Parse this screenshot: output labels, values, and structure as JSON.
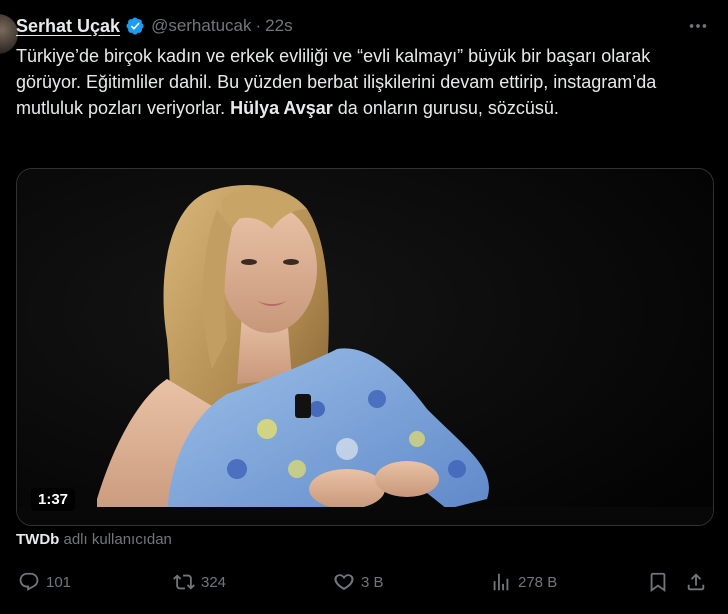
{
  "author": {
    "name": "Serhat Uçak",
    "handle": "@serhatucak",
    "separator": "·",
    "time": "22s",
    "verified_icon": "verified-badge-icon"
  },
  "tweet": {
    "text_part1": "Türkiye’de birçok kadın ve erkek evliliği ve “evli kalmayı” büyük bir başarı olarak görüyor. Eğitimliler dahil. Bu yüzden berbat ilişkilerini devam ettirip, instagram’da mutluluk pozları veriyorlar. ",
    "text_bold": "Hülya Avşar",
    "text_part2": " da onların gurusu, sözcüsü."
  },
  "media": {
    "duration": "1:37"
  },
  "attribution": {
    "source": "TWDb",
    "suffix": " adlı kullanıcıdan"
  },
  "actions": {
    "replies": "101",
    "retweets": "324",
    "likes": "3 B",
    "views": "278 B"
  },
  "colors": {
    "background": "#000000",
    "text": "#e7e9ea",
    "muted": "#71767b",
    "verified": "#1d9bf0",
    "border": "#2f3336"
  }
}
